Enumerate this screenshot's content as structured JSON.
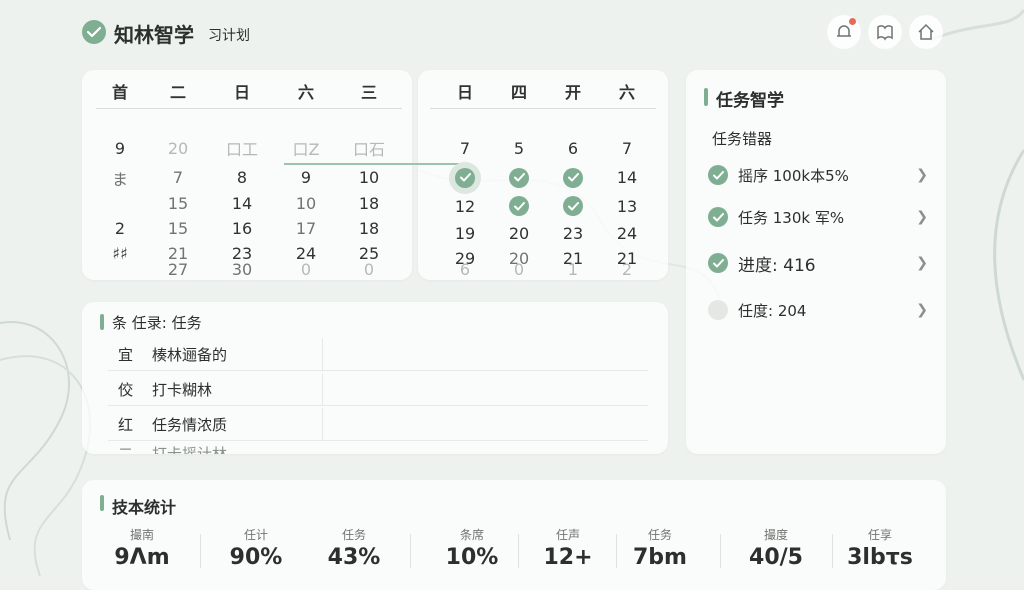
{
  "header": {
    "app_title": "知林智学",
    "subtitle": "习计划"
  },
  "calendar": {
    "left_headers": [
      "首",
      "二",
      "日",
      "六",
      "三"
    ],
    "right_headers": [
      "日",
      "四",
      "开",
      "六"
    ],
    "left_rows": [
      [
        "9",
        "20",
        "口工",
        "口Z",
        "口石"
      ],
      [
        "ま",
        "7",
        "8",
        "9",
        "10"
      ],
      [
        "",
        "15",
        "14",
        "10",
        "18"
      ],
      [
        "2",
        "15",
        "16",
        "17",
        "18"
      ],
      [
        "♯♯",
        "21",
        "23",
        "24",
        "25"
      ],
      [
        "",
        "27",
        "30",
        "0",
        "0"
      ]
    ],
    "right_rows": [
      [
        "7",
        "5",
        "6",
        "7"
      ],
      [
        "",
        "",
        "",
        "14"
      ],
      [
        "12",
        "",
        "",
        "13"
      ],
      [
        "19",
        "20",
        "23",
        "24"
      ],
      [
        "29",
        "20",
        "21",
        "21"
      ],
      [
        "6",
        "0",
        "1",
        "2"
      ]
    ]
  },
  "side_panel": {
    "title": "任务智学",
    "subtitle": "任务错器",
    "items": [
      {
        "label": "摇序 100k本5%",
        "checked": true
      },
      {
        "label": "任务 130k 军%",
        "checked": true
      },
      {
        "label": "进度: 416",
        "checked": true
      },
      {
        "label": "任度: 204",
        "checked": false
      }
    ]
  },
  "task_panel": {
    "title": "条 任录: 任务",
    "rows": [
      {
        "tag": "宜",
        "text": "楱林逦备的"
      },
      {
        "tag": "佼",
        "text": "打卡糊林"
      },
      {
        "tag": "红",
        "text": "任务情浓质"
      },
      {
        "tag": "二",
        "text": "打卡摇计林"
      }
    ]
  },
  "stats": {
    "title": "技本统计",
    "items": [
      {
        "label": "撮南",
        "value": "9Λm"
      },
      {
        "label": "任计",
        "value": "90%"
      },
      {
        "label": "任务",
        "value": "43%"
      },
      {
        "label": "条席",
        "value": "10%"
      },
      {
        "label": "任声",
        "value": "12+"
      },
      {
        "label": "任务",
        "value": "7bm"
      },
      {
        "label": "撮度",
        "value": "40/5"
      },
      {
        "label": "任享",
        "value": "3lbτs"
      }
    ]
  },
  "colors": {
    "accent": "#7fae93",
    "background": "#eef2ef",
    "notification": "#e56a5b"
  }
}
